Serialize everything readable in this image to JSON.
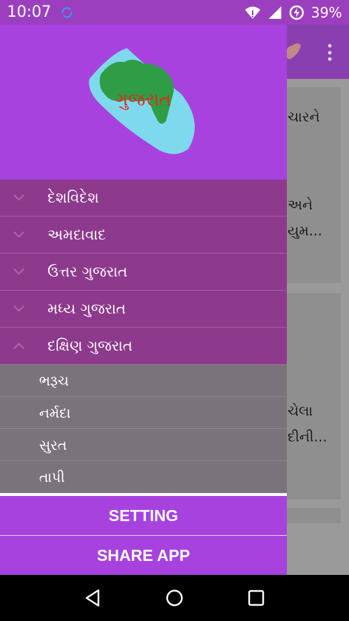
{
  "status_bar": {
    "time": "10:07",
    "battery_percent": "39%",
    "icons": [
      "sync-icon",
      "wifi-icon",
      "signal-icon",
      "battery-charging-icon"
    ]
  },
  "background_app": {
    "card_texts": [
      "ચારને",
      "અને",
      "યુમ...",
      "ચેલા",
      "દીની..."
    ]
  },
  "drawer": {
    "logo_text": "ગુજરાત",
    "menu": [
      {
        "label": "દેશવિદેશ",
        "expanded": false
      },
      {
        "label": "અમદાવાદ",
        "expanded": false
      },
      {
        "label": "ઉત્તર ગુજરાત",
        "expanded": false
      },
      {
        "label": "મધ્ય ગુજરાત",
        "expanded": false
      },
      {
        "label": "દક્ષિણ ગુજરાત",
        "expanded": true
      }
    ],
    "submenu": [
      "ભરૂચ",
      "નર્મદા",
      "સુરત",
      "તાપી"
    ],
    "footer": {
      "setting_label": "SETTING",
      "share_label": "SHARE APP"
    }
  },
  "colors": {
    "drawer_header": "#a742df",
    "menu_bg": "#8d3a8c",
    "submenu_bg": "#7b737b",
    "status_bar": "#9b3fbf"
  }
}
